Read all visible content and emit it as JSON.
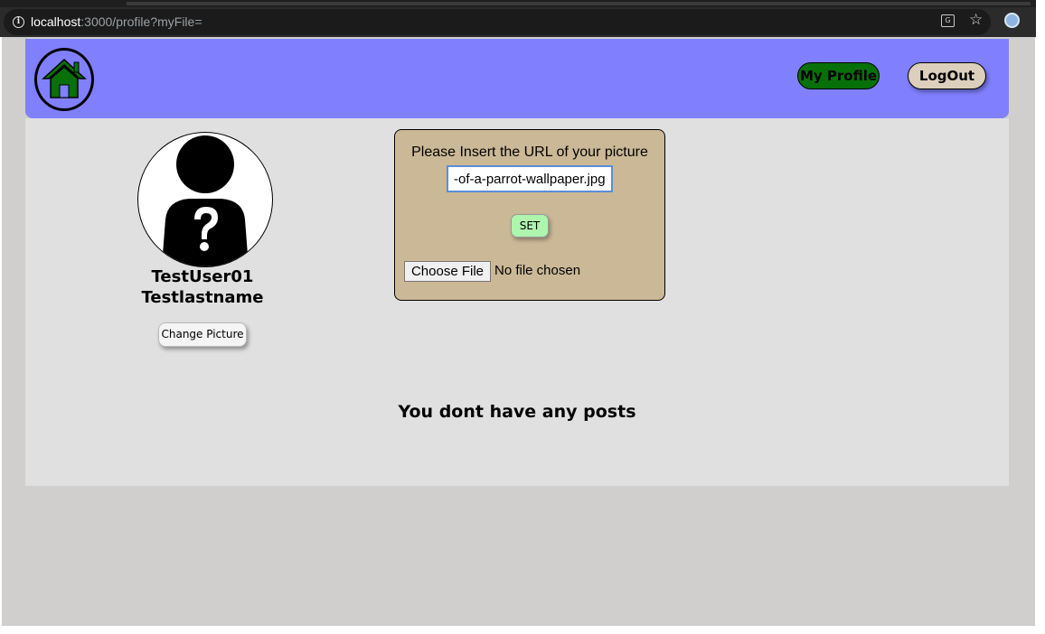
{
  "browser": {
    "url_host": "localhost",
    "url_rest": ":3000/profile?myFile="
  },
  "navbar": {
    "my_profile_label": "My Profile",
    "logout_label": "LogOut"
  },
  "profile": {
    "first_name": "TestUser01",
    "last_name": "Testlastname",
    "change_picture_label": "Change Picture"
  },
  "upload": {
    "prompt": "Please Insert the URL of your picture",
    "url_value": "-of-a-parrot-wallpaper.jpg",
    "set_label": "SET",
    "choose_file_label": "Choose File",
    "no_file_text": "No file chosen"
  },
  "posts": {
    "empty_message": "You dont have any posts"
  },
  "colors": {
    "navbar": "#8080ff",
    "content_bg": "#e0e0e0",
    "page_bg": "#d0cfcd",
    "my_profile_bg": "#087008",
    "logout_bg": "#dcd0bc",
    "upload_panel_bg": "#cbb896",
    "set_button_bg": "#aef5ae"
  }
}
